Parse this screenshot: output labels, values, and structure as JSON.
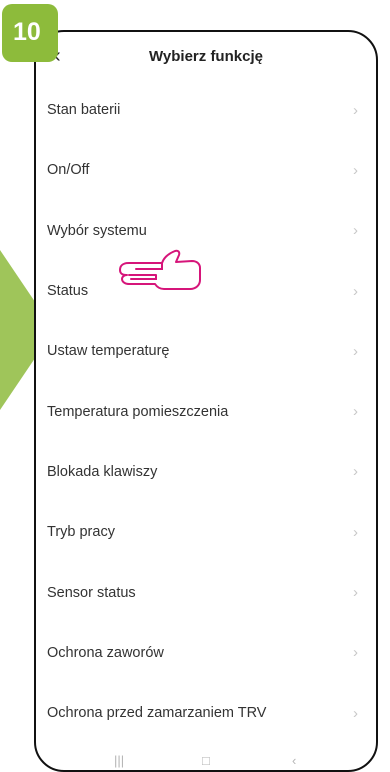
{
  "step": {
    "number": "10"
  },
  "header": {
    "back_icon": "chevron-left-icon",
    "title": "Wybierz funkcję"
  },
  "menu": {
    "items": [
      {
        "label": "Stan baterii"
      },
      {
        "label": "On/Off"
      },
      {
        "label": "Wybór systemu"
      },
      {
        "label": "Status"
      },
      {
        "label": "Ustaw temperaturę"
      },
      {
        "label": "Temperatura pomieszczenia"
      },
      {
        "label": "Blokada klawiszy"
      },
      {
        "label": "Tryb pracy"
      },
      {
        "label": "Sensor status"
      },
      {
        "label": "Ochrona zaworów"
      },
      {
        "label": "Ochrona przed zamarzaniem TRV"
      }
    ],
    "chevron_icon": "chevron-right-icon"
  },
  "colors": {
    "accent_green": "#8dbb3b",
    "pointer_pink": "#d6157a",
    "chevron_gray": "#c8c8c8"
  },
  "annotation": {
    "pointer_icon": "pointing-hand-icon",
    "pointed_item": "Status"
  }
}
